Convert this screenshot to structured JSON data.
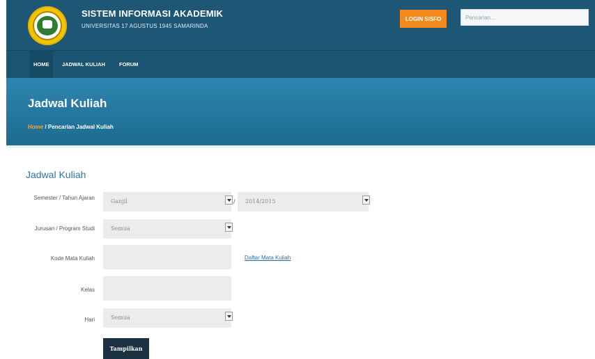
{
  "header": {
    "title": "SISTEM INFORMASI AKADEMIK",
    "subtitle": "UNIVERSITAS 17 AGUSTUS 1945 SAMARINDA",
    "login_label": "LOGIN SISFO",
    "search_placeholder": "Pencarian..."
  },
  "nav": {
    "items": [
      {
        "label": "HOME",
        "active": true
      },
      {
        "label": "JADWAL KULIAH"
      },
      {
        "label": "FORUM"
      }
    ]
  },
  "hero": {
    "title": "Jadwal Kuliah",
    "breadcrumb_home": "Home",
    "breadcrumb_current": " / Pencarian Jadwal Kuliah"
  },
  "form": {
    "section_title": "Jadwal Kuliah",
    "semester_label": "Semester / Tahun Ajaran",
    "semester_value": "Ganjil",
    "tahun_separator": "/",
    "tahun_value": "2014/2015",
    "jurusan_label": "Jurusan / Program Studi",
    "jurusan_value": "Semua",
    "kode_label": "Kode Mata Kuliah",
    "kode_value": "",
    "daftar_link": "Daftar Mata Kuliah",
    "kelas_label": "Kelas",
    "kelas_value": "",
    "hari_label": "Hari",
    "hari_value": "Semua",
    "submit_label": "Tampilkan"
  },
  "colors": {
    "topbar": "#1d5775",
    "hero": "#2c86b0",
    "accent": "#f28a1e",
    "link": "#2a6fb0"
  }
}
